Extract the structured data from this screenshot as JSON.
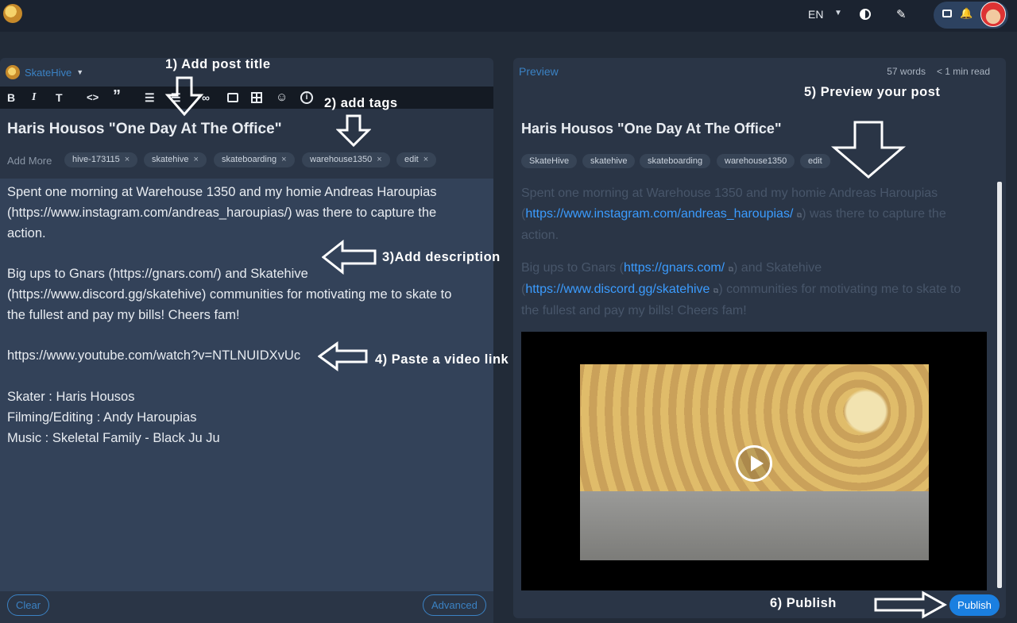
{
  "topbar": {
    "language": "EN",
    "logo_icon": "skatehive-logo-icon",
    "icons": [
      "theme-toggle-icon",
      "pen-icon",
      "wallet-icon",
      "bell-icon",
      "avatar"
    ]
  },
  "editor": {
    "community": "SkateHive",
    "toolbar": {
      "bold": "B",
      "italic": "I",
      "heading": "T",
      "code": "<>",
      "quote": "”"
    },
    "title": "Haris Housos \"One Day At The Office\"",
    "add_more_placeholder": "Add More",
    "tags": [
      "hive-173115",
      "skatehive",
      "skateboarding",
      "warehouse1350",
      "edit"
    ],
    "tag_remove": "×",
    "body_lines": [
      "Spent one morning at Warehouse 1350 and my homie Andreas Haroupias",
      "(https://www.instagram.com/andreas_haroupias/) was there to capture the",
      "action.",
      "",
      "Big ups to Gnars (https://gnars.com/) and Skatehive",
      "(https://www.discord.gg/skatehive) communities for motivating me to skate to",
      "the fullest and pay my bills! Cheers fam!",
      "",
      "https://www.youtube.com/watch?v=NTLNUIDXvUc",
      "",
      "Skater : Haris Housos",
      "Filming/Editing : Andy Haroupias",
      "Music : Skeletal Family - Black Ju Ju"
    ],
    "clear_label": "Clear",
    "advanced_label": "Advanced"
  },
  "preview": {
    "label": "Preview",
    "words": "57 words",
    "read_time": "< 1 min read",
    "title": "Haris Housos \"One Day At The Office\"",
    "tags": [
      "SkateHive",
      "skatehive",
      "skateboarding",
      "warehouse1350",
      "edit"
    ],
    "p1_a": "Spent one morning at Warehouse 1350 and my homie Andreas Haroupias (",
    "p1_link": "https://www.instagram.com/andreas_haroupias/",
    "p1_b": ") was there to capture the action.",
    "p2_a": "Big ups to Gnars (",
    "p2_link1": "https://gnars.com/",
    "p2_b": ") and Skatehive (",
    "p2_link2": "https://www.discord.gg/skatehive",
    "p2_c": ") communities for motivating me to skate to the fullest and pay my bills! Cheers fam!",
    "external_icon": "⧉",
    "publish_label": "Publish"
  },
  "annotations": {
    "a1": "1) Add post title",
    "a2": "2) add tags",
    "a3": "3)Add description",
    "a4": "4) Paste a video link",
    "a5": "5) Preview your post",
    "a6": "6) Publish"
  }
}
